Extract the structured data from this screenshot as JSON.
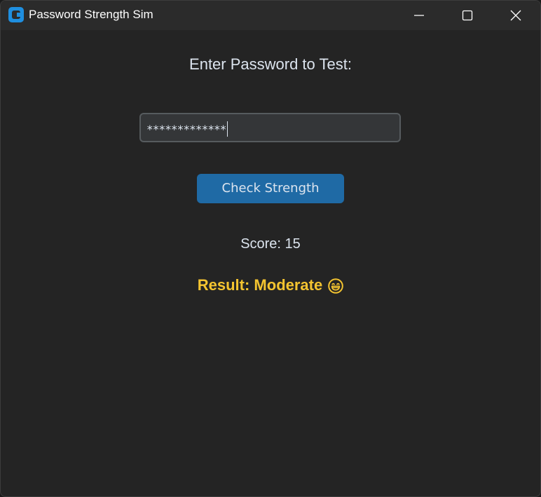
{
  "window": {
    "title": "Password Strength Sim",
    "controls": [
      "minimize-icon",
      "maximize-icon",
      "close-icon"
    ]
  },
  "form": {
    "prompt": "Enter Password to Test:",
    "password_masked": "*************",
    "check_button_label": "Check Strength"
  },
  "results": {
    "score_text": "Score: 15",
    "result_text": "Result: Moderate",
    "result_icon": "grinning-face-icon"
  },
  "colors": {
    "accent": "#1f6aa5",
    "result": "#f4c430",
    "background": "#242424"
  }
}
